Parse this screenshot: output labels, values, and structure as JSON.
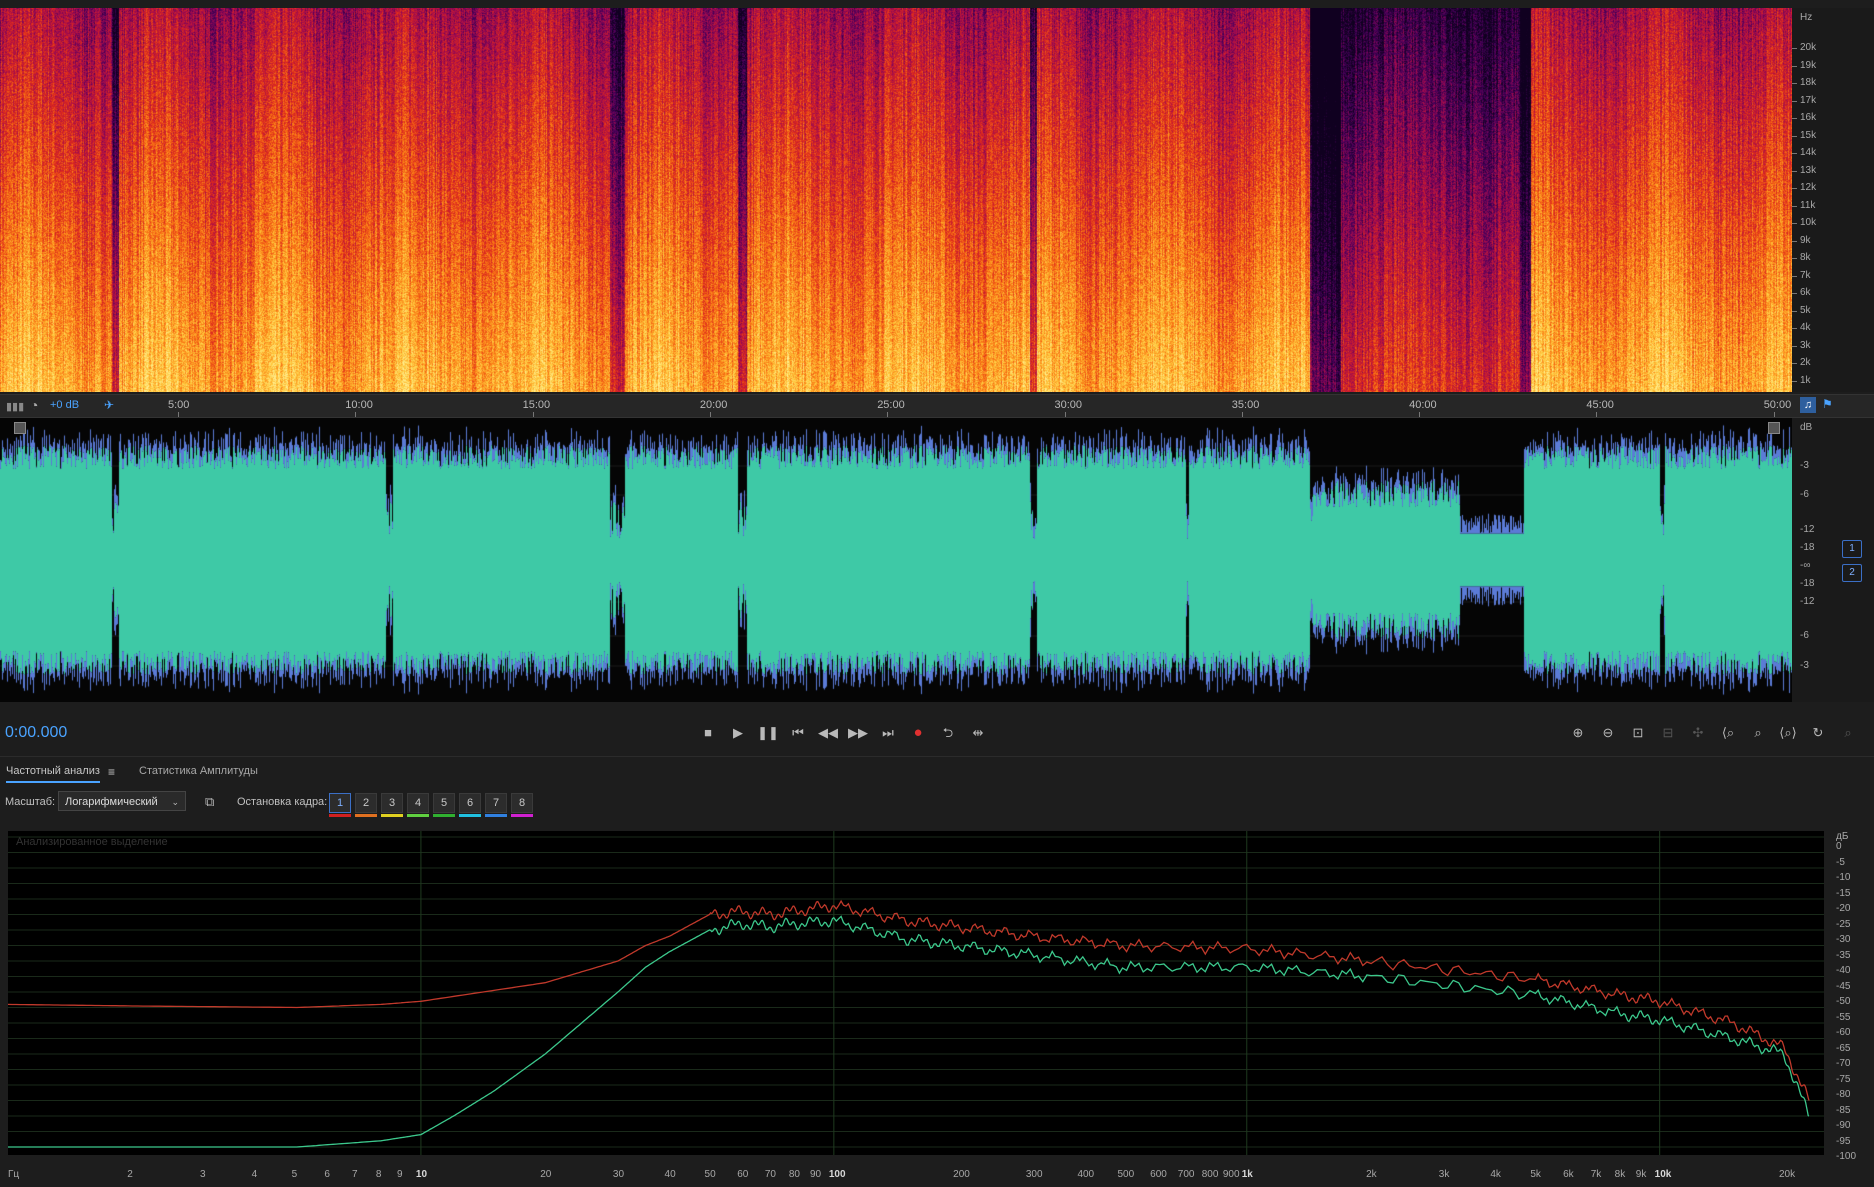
{
  "spectrogram": {
    "unit_label": "Hz",
    "freq_labels": [
      "20k",
      "19k",
      "18k",
      "17k",
      "16k",
      "15k",
      "14k",
      "13k",
      "12k",
      "11k",
      "10k",
      "9k",
      "8k",
      "7k",
      "6k",
      "5k",
      "4k",
      "3k",
      "2k",
      "1k"
    ]
  },
  "ruler": {
    "level_label": "+0 dB",
    "time_labels": [
      "5:00",
      "10:00",
      "15:00",
      "20:00",
      "25:00",
      "30:00",
      "35:00",
      "40:00",
      "45:00",
      "50:00"
    ]
  },
  "waveform": {
    "unit_label": "dB",
    "db_labels": [
      "-3",
      "-6",
      "-12",
      "-18",
      "-∞",
      "-18",
      "-12",
      "-6",
      "-3"
    ],
    "channels": [
      "1",
      "2"
    ],
    "colors": {
      "fill": "#3ec9a6",
      "edge": "#5b7bd6"
    }
  },
  "transport": {
    "timecode": "0:00.000"
  },
  "panel": {
    "tabs": [
      "Частотный анализ",
      "Статистика Амплитуды"
    ],
    "scale_label": "Масштаб:",
    "scale_value": "Логарифмический",
    "freeze_label": "Остановка кадра:",
    "frames": [
      "1",
      "2",
      "3",
      "4",
      "5",
      "6",
      "7",
      "8"
    ],
    "frame_colors": [
      "#d02020",
      "#e07020",
      "#e0d020",
      "#60d040",
      "#30b030",
      "#20c0e0",
      "#3080e0",
      "#d020d0"
    ]
  },
  "frequency_analysis": {
    "overlay_label": "Анализированное выделение",
    "db_unit": "дБ",
    "db_labels": [
      "0",
      "-5",
      "-10",
      "-15",
      "-20",
      "-25",
      "-30",
      "-35",
      "-40",
      "-45",
      "-50",
      "-55",
      "-60",
      "-65",
      "-70",
      "-75",
      "-80",
      "-85",
      "-90",
      "-95",
      "-100"
    ],
    "freq_unit": "Гц",
    "freq_labels": [
      "2",
      "3",
      "4",
      "5",
      "6",
      "7",
      "8",
      "9",
      "10",
      "20",
      "30",
      "40",
      "50",
      "60",
      "70",
      "80",
      "90",
      "100",
      "200",
      "300",
      "400",
      "500",
      "600",
      "700",
      "800",
      "900",
      "1k",
      "2k",
      "3k",
      "4k",
      "5k",
      "6k",
      "7k",
      "8k",
      "9k",
      "10k",
      "20k"
    ]
  },
  "chart_data": {
    "type": "line",
    "xlabel": "Гц",
    "ylabel": "дБ",
    "x_scale": "log",
    "xlim": [
      1,
      25000
    ],
    "ylim": [
      -100,
      0
    ],
    "grid": true,
    "series": [
      {
        "color": "#c0392b",
        "x": [
          1,
          2,
          5,
          8,
          10,
          20,
          30,
          35,
          40,
          50,
          60,
          70,
          80,
          100,
          150,
          200,
          300,
          500,
          1000,
          2000,
          5000,
          8000,
          10000,
          15000,
          20000,
          23000
        ],
        "y": [
          -54,
          -54.5,
          -55,
          -54,
          -53,
          -47,
          -40,
          -35,
          -32,
          -25,
          -24,
          -25,
          -24,
          -22,
          -27,
          -29,
          -32,
          -35,
          -36,
          -40,
          -46,
          -51,
          -53,
          -60,
          -68,
          -85
        ]
      },
      {
        "color": "#3cc88c",
        "x": [
          1,
          2,
          5,
          8,
          10,
          12,
          15,
          20,
          30,
          35,
          40,
          50,
          60,
          70,
          80,
          100,
          150,
          200,
          300,
          500,
          1000,
          2000,
          5000,
          8000,
          10000,
          15000,
          20000,
          23000
        ],
        "y": [
          -100,
          -100,
          -100,
          -98,
          -96,
          -90,
          -82,
          -70,
          -50,
          -42,
          -37,
          -30,
          -28,
          -29,
          -28,
          -27,
          -33,
          -35,
          -38,
          -42,
          -42,
          -45,
          -51,
          -57,
          -59,
          -65,
          -70,
          -90
        ]
      }
    ]
  }
}
